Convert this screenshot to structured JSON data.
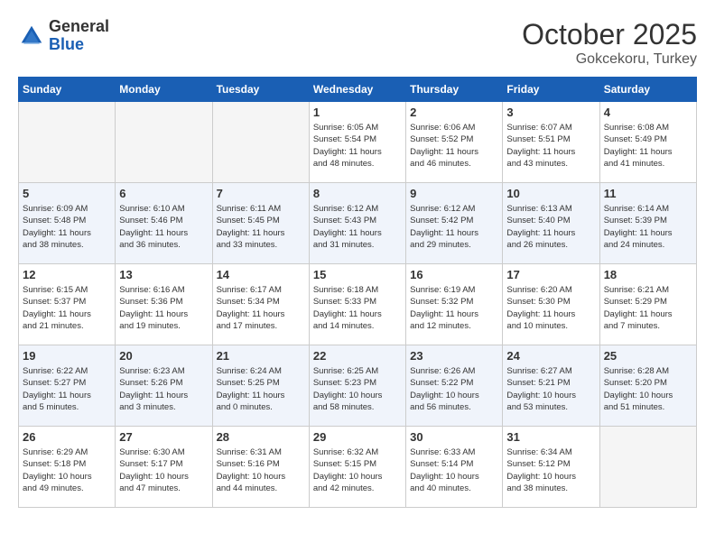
{
  "logo": {
    "general": "General",
    "blue": "Blue"
  },
  "title": "October 2025",
  "subtitle": "Gokcekoru, Turkey",
  "days_of_week": [
    "Sunday",
    "Monday",
    "Tuesday",
    "Wednesday",
    "Thursday",
    "Friday",
    "Saturday"
  ],
  "weeks": [
    {
      "row_class": "row-white",
      "days": [
        {
          "number": "",
          "info": "",
          "empty": true
        },
        {
          "number": "",
          "info": "",
          "empty": true
        },
        {
          "number": "",
          "info": "",
          "empty": true
        },
        {
          "number": "1",
          "info": "Sunrise: 6:05 AM\nSunset: 5:54 PM\nDaylight: 11 hours\nand 48 minutes.",
          "empty": false
        },
        {
          "number": "2",
          "info": "Sunrise: 6:06 AM\nSunset: 5:52 PM\nDaylight: 11 hours\nand 46 minutes.",
          "empty": false
        },
        {
          "number": "3",
          "info": "Sunrise: 6:07 AM\nSunset: 5:51 PM\nDaylight: 11 hours\nand 43 minutes.",
          "empty": false
        },
        {
          "number": "4",
          "info": "Sunrise: 6:08 AM\nSunset: 5:49 PM\nDaylight: 11 hours\nand 41 minutes.",
          "empty": false
        }
      ]
    },
    {
      "row_class": "row-blue",
      "days": [
        {
          "number": "5",
          "info": "Sunrise: 6:09 AM\nSunset: 5:48 PM\nDaylight: 11 hours\nand 38 minutes.",
          "empty": false
        },
        {
          "number": "6",
          "info": "Sunrise: 6:10 AM\nSunset: 5:46 PM\nDaylight: 11 hours\nand 36 minutes.",
          "empty": false
        },
        {
          "number": "7",
          "info": "Sunrise: 6:11 AM\nSunset: 5:45 PM\nDaylight: 11 hours\nand 33 minutes.",
          "empty": false
        },
        {
          "number": "8",
          "info": "Sunrise: 6:12 AM\nSunset: 5:43 PM\nDaylight: 11 hours\nand 31 minutes.",
          "empty": false
        },
        {
          "number": "9",
          "info": "Sunrise: 6:12 AM\nSunset: 5:42 PM\nDaylight: 11 hours\nand 29 minutes.",
          "empty": false
        },
        {
          "number": "10",
          "info": "Sunrise: 6:13 AM\nSunset: 5:40 PM\nDaylight: 11 hours\nand 26 minutes.",
          "empty": false
        },
        {
          "number": "11",
          "info": "Sunrise: 6:14 AM\nSunset: 5:39 PM\nDaylight: 11 hours\nand 24 minutes.",
          "empty": false
        }
      ]
    },
    {
      "row_class": "row-white",
      "days": [
        {
          "number": "12",
          "info": "Sunrise: 6:15 AM\nSunset: 5:37 PM\nDaylight: 11 hours\nand 21 minutes.",
          "empty": false
        },
        {
          "number": "13",
          "info": "Sunrise: 6:16 AM\nSunset: 5:36 PM\nDaylight: 11 hours\nand 19 minutes.",
          "empty": false
        },
        {
          "number": "14",
          "info": "Sunrise: 6:17 AM\nSunset: 5:34 PM\nDaylight: 11 hours\nand 17 minutes.",
          "empty": false
        },
        {
          "number": "15",
          "info": "Sunrise: 6:18 AM\nSunset: 5:33 PM\nDaylight: 11 hours\nand 14 minutes.",
          "empty": false
        },
        {
          "number": "16",
          "info": "Sunrise: 6:19 AM\nSunset: 5:32 PM\nDaylight: 11 hours\nand 12 minutes.",
          "empty": false
        },
        {
          "number": "17",
          "info": "Sunrise: 6:20 AM\nSunset: 5:30 PM\nDaylight: 11 hours\nand 10 minutes.",
          "empty": false
        },
        {
          "number": "18",
          "info": "Sunrise: 6:21 AM\nSunset: 5:29 PM\nDaylight: 11 hours\nand 7 minutes.",
          "empty": false
        }
      ]
    },
    {
      "row_class": "row-blue",
      "days": [
        {
          "number": "19",
          "info": "Sunrise: 6:22 AM\nSunset: 5:27 PM\nDaylight: 11 hours\nand 5 minutes.",
          "empty": false
        },
        {
          "number": "20",
          "info": "Sunrise: 6:23 AM\nSunset: 5:26 PM\nDaylight: 11 hours\nand 3 minutes.",
          "empty": false
        },
        {
          "number": "21",
          "info": "Sunrise: 6:24 AM\nSunset: 5:25 PM\nDaylight: 11 hours\nand 0 minutes.",
          "empty": false
        },
        {
          "number": "22",
          "info": "Sunrise: 6:25 AM\nSunset: 5:23 PM\nDaylight: 10 hours\nand 58 minutes.",
          "empty": false
        },
        {
          "number": "23",
          "info": "Sunrise: 6:26 AM\nSunset: 5:22 PM\nDaylight: 10 hours\nand 56 minutes.",
          "empty": false
        },
        {
          "number": "24",
          "info": "Sunrise: 6:27 AM\nSunset: 5:21 PM\nDaylight: 10 hours\nand 53 minutes.",
          "empty": false
        },
        {
          "number": "25",
          "info": "Sunrise: 6:28 AM\nSunset: 5:20 PM\nDaylight: 10 hours\nand 51 minutes.",
          "empty": false
        }
      ]
    },
    {
      "row_class": "row-white",
      "days": [
        {
          "number": "26",
          "info": "Sunrise: 6:29 AM\nSunset: 5:18 PM\nDaylight: 10 hours\nand 49 minutes.",
          "empty": false
        },
        {
          "number": "27",
          "info": "Sunrise: 6:30 AM\nSunset: 5:17 PM\nDaylight: 10 hours\nand 47 minutes.",
          "empty": false
        },
        {
          "number": "28",
          "info": "Sunrise: 6:31 AM\nSunset: 5:16 PM\nDaylight: 10 hours\nand 44 minutes.",
          "empty": false
        },
        {
          "number": "29",
          "info": "Sunrise: 6:32 AM\nSunset: 5:15 PM\nDaylight: 10 hours\nand 42 minutes.",
          "empty": false
        },
        {
          "number": "30",
          "info": "Sunrise: 6:33 AM\nSunset: 5:14 PM\nDaylight: 10 hours\nand 40 minutes.",
          "empty": false
        },
        {
          "number": "31",
          "info": "Sunrise: 6:34 AM\nSunset: 5:12 PM\nDaylight: 10 hours\nand 38 minutes.",
          "empty": false
        },
        {
          "number": "",
          "info": "",
          "empty": true
        }
      ]
    }
  ]
}
